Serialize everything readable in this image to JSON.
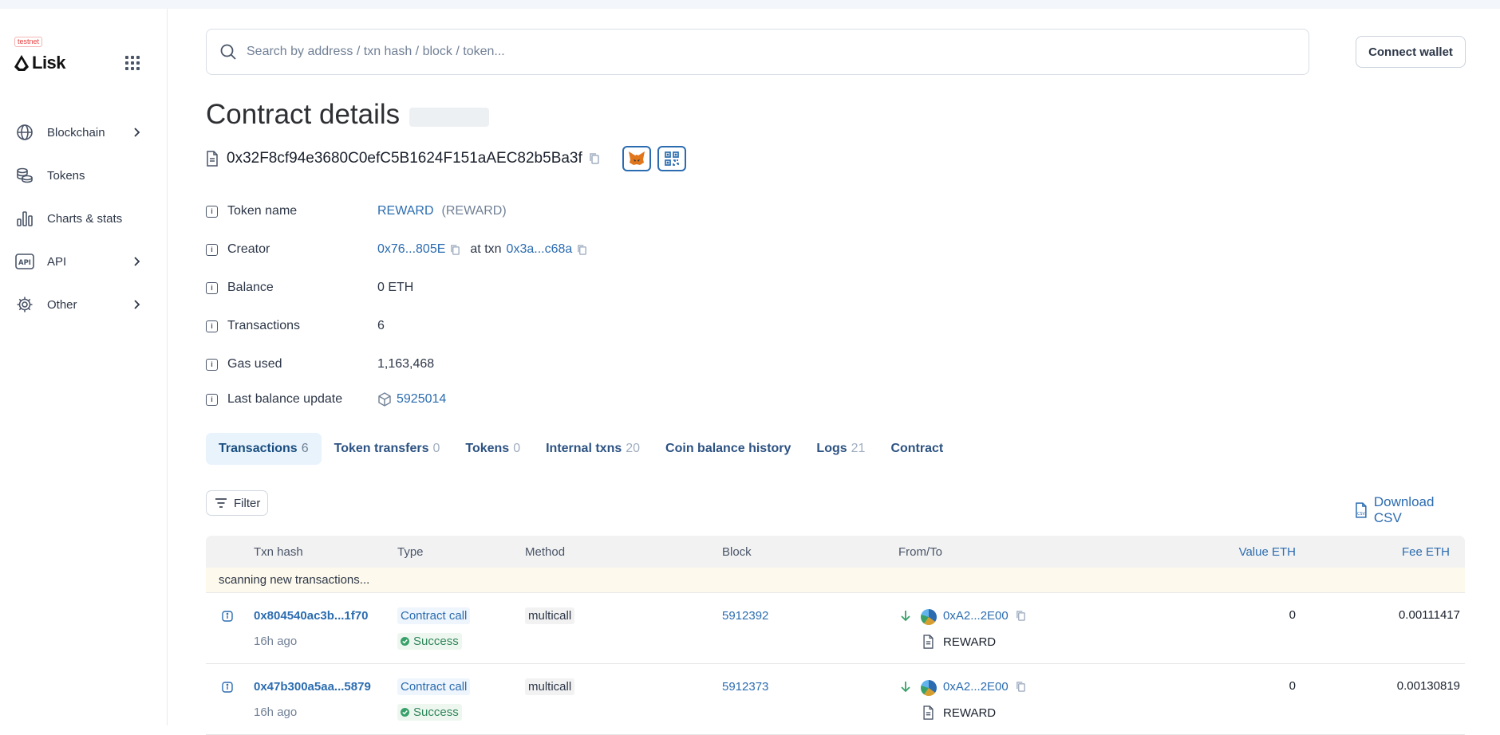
{
  "sidebar": {
    "badge": "testnet",
    "logo": "Lisk",
    "items": [
      {
        "label": "Blockchain",
        "icon": "globe-icon",
        "chevron": true
      },
      {
        "label": "Tokens",
        "icon": "coins-icon",
        "chevron": false
      },
      {
        "label": "Charts & stats",
        "icon": "bar-chart-icon",
        "chevron": false
      },
      {
        "label": "API",
        "icon": "api-icon",
        "chevron": true
      },
      {
        "label": "Other",
        "icon": "gear-icon",
        "chevron": true
      }
    ]
  },
  "header": {
    "search_placeholder": "Search by address / txn hash / block / token...",
    "connect_label": "Connect wallet"
  },
  "page": {
    "title": "Contract details",
    "address": "0x32F8cf94e3680C0efC5B1624F151aAEC82b5Ba3f"
  },
  "details": {
    "token_name": {
      "label": "Token name",
      "name": "REWARD",
      "symbol": "(REWARD)"
    },
    "creator": {
      "label": "Creator",
      "address": "0x76...805E",
      "at_txn": "at txn",
      "txn": "0x3a...c68a"
    },
    "balance": {
      "label": "Balance",
      "value": "0 ETH"
    },
    "transactions": {
      "label": "Transactions",
      "value": "6"
    },
    "gas_used": {
      "label": "Gas used",
      "value": "1,163,468"
    },
    "last_balance_update": {
      "label": "Last balance update",
      "value": "5925014"
    }
  },
  "tabs": [
    {
      "label": "Transactions",
      "count": "6",
      "active": true
    },
    {
      "label": "Token transfers",
      "count": "0",
      "active": false
    },
    {
      "label": "Tokens",
      "count": "0",
      "active": false
    },
    {
      "label": "Internal txns",
      "count": "20",
      "active": false
    },
    {
      "label": "Coin balance history",
      "count": "",
      "active": false
    },
    {
      "label": "Logs",
      "count": "21",
      "active": false
    },
    {
      "label": "Contract",
      "count": "",
      "active": false
    }
  ],
  "toolbar": {
    "filter_label": "Filter",
    "csv_label": "Download CSV"
  },
  "table": {
    "headers": {
      "txn_hash": "Txn hash",
      "type": "Type",
      "method": "Method",
      "block": "Block",
      "from_to": "From/To",
      "value": "Value ETH",
      "fee": "Fee ETH"
    },
    "scanning": "scanning new transactions...",
    "rows": [
      {
        "hash": "0x804540ac3b...1f70",
        "age": "16h ago",
        "type": "Contract call",
        "status": "Success",
        "method": "multicall",
        "block": "5912392",
        "from": "0xA2...2E00",
        "to": "REWARD",
        "value": "0",
        "fee": "0.00111417"
      },
      {
        "hash": "0x47b300a5aa...5879",
        "age": "16h ago",
        "type": "Contract call",
        "status": "Success",
        "method": "multicall",
        "block": "5912373",
        "from": "0xA2...2E00",
        "to": "REWARD",
        "value": "0",
        "fee": "0.00130819"
      }
    ]
  }
}
